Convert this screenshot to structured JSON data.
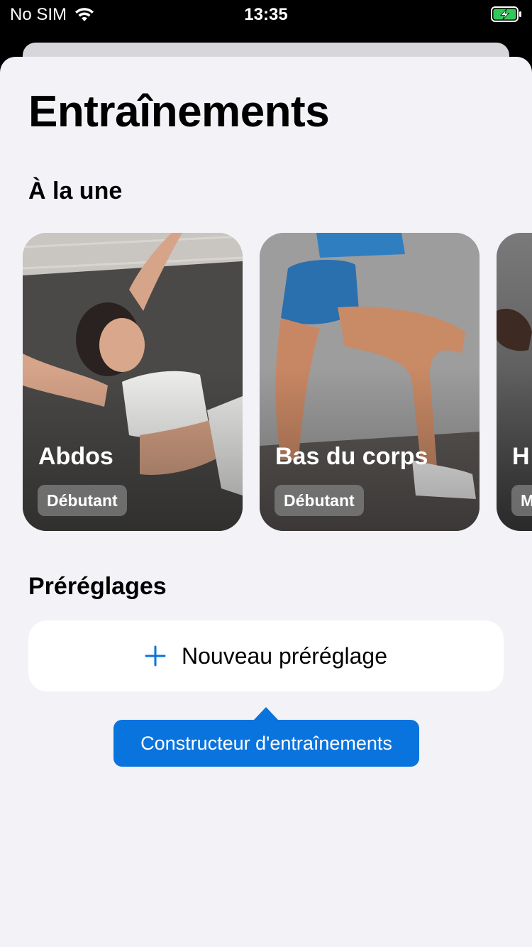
{
  "status_bar": {
    "carrier": "No SIM",
    "time": "13:35",
    "wifi_icon": "wifi-icon",
    "battery_icon": "battery-charging-icon"
  },
  "page": {
    "title": "Entraînements"
  },
  "featured": {
    "title": "À la une",
    "cards": [
      {
        "title": "Abdos",
        "level": "Débutant"
      },
      {
        "title": "Bas du corps",
        "level": "Débutant"
      },
      {
        "title": "H",
        "level": "M"
      }
    ]
  },
  "presets": {
    "title": "Préréglages",
    "new_preset_label": "Nouveau préréglage",
    "plus_icon": "plus-icon"
  },
  "tooltip": {
    "text": "Constructeur d'entraînements"
  },
  "colors": {
    "accent": "#0a74de",
    "background": "#f2f2f7",
    "battery_green": "#34c759"
  }
}
